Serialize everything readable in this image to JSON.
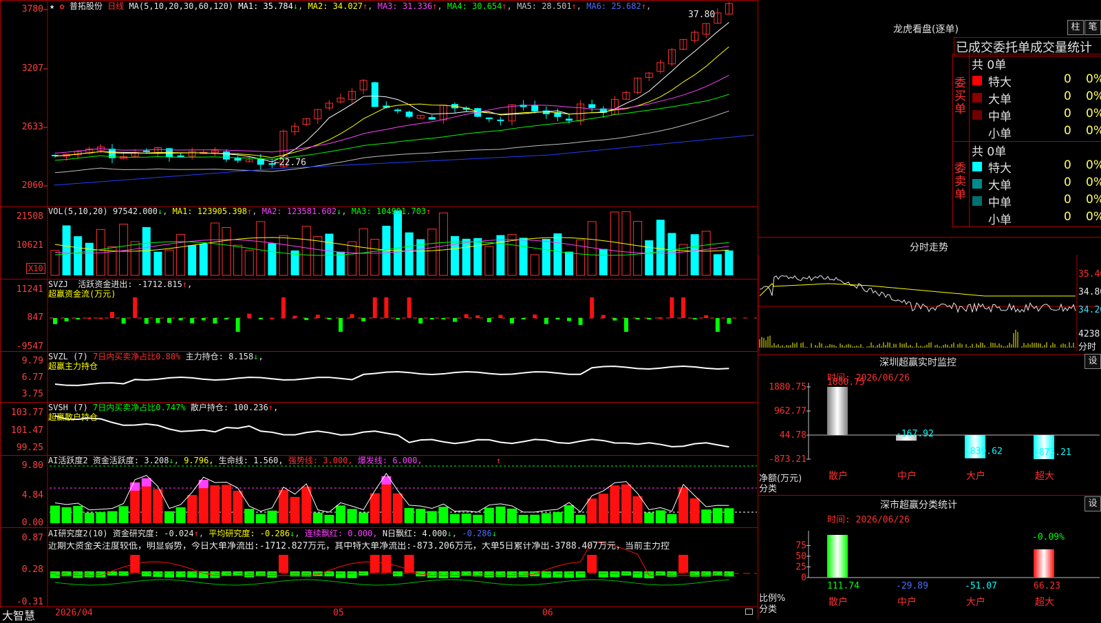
{
  "main": {
    "name": "普拓股份",
    "period": "日线",
    "ma_label": "MA(5,10,20,30,60,120)",
    "ma": [
      {
        "label": "MA1:",
        "value": "35.784",
        "arrow": "↓",
        "color": "#ffffff"
      },
      {
        "label": "MA2:",
        "value": "34.027",
        "arrow": "↑",
        "color": "#ffff00"
      },
      {
        "label": "MA3:",
        "value": "31.336",
        "arrow": "↑",
        "color": "#ff40ff"
      },
      {
        "label": "MA4:",
        "value": "30.654",
        "arrow": "↑",
        "color": "#00ff00"
      },
      {
        "label": "MA5:",
        "value": "28.501",
        "arrow": "↑",
        "color": "#c0c0c0"
      },
      {
        "label": "MA6:",
        "value": "25.682",
        "arrow": "↑",
        "color": "#4a6cff"
      }
    ],
    "y_labels": [
      "3780",
      "3207",
      "2633",
      "2060"
    ],
    "high_label": "37.80",
    "low_label": "22.76"
  },
  "vol": {
    "title": "VOL(5,10,20)",
    "value": "97542.000",
    "arrow": "↓",
    "ma1": "MA1: 123905.398",
    "ma1a": "↑",
    "ma2": "MA2: 123581.602",
    "ma2a": "↓",
    "ma3": "MA3: 104991.703",
    "ma3a": "↑",
    "y_labels": [
      "21508",
      "10621"
    ],
    "unit": "X10"
  },
  "svzj": {
    "title": "SVZJ",
    "label": "活跃资金进出: -1712.815",
    "arrow": "↑",
    "tail": ",",
    "sub": "超赢资金流(万元)",
    "y_labels": [
      "11241",
      "847",
      "-9547"
    ]
  },
  "svzl": {
    "title": "SVZL (7)",
    "pct": "7日内买卖净占比0.88%",
    "main_label": "主力持仓: 8.158",
    "arrow": "↓",
    "tail": ",",
    "sub": "超赢主力持仓",
    "y_labels": [
      "9.79",
      "6.77",
      "3.75"
    ]
  },
  "svsh": {
    "title": "SVSH (7)",
    "pct": "7日内买卖净占比0.747%",
    "main_label": "散户持仓: 100.236",
    "arrow": "↑",
    "tail": ",",
    "sub": "超赢散户持仓",
    "y_labels": [
      "103.77",
      "101.47",
      "99.25"
    ]
  },
  "ai1": {
    "title": "AI活跃度2",
    "a": "资金活跃度: 3.208",
    "aa": "↓",
    "b": "9.796,",
    "c": "生命线: 1.560,",
    "d": "强势线: 3.000,",
    "e": "爆发线: 6.000,",
    "f": "↑",
    "y_labels": [
      "9.80",
      "4.84",
      "0.00"
    ]
  },
  "ai2": {
    "title": "AI研究度2(10)",
    "a": "资金研究度: -0.024",
    "aa": "↑",
    "b": "平均研究度: -0.286",
    "ba": "↓",
    "c": "连续飘红: 0.000,",
    "d": "N日飘红: 4.000",
    "da": "↓",
    "e": "-0.286",
    "ea": "↓",
    "note": "近期大资金关注度较低，明显弱势，今日大单净流出:-1712.827万元，其中特大单净流出:-873.206万元，大单5日累计净出-3788.407万元，当前主力控",
    "y_labels": [
      "0.87",
      "0.28",
      "-0.31"
    ]
  },
  "xaxis": {
    "brand": "大智慧",
    "d1": "2026/04",
    "d2": "05",
    "d3": "06"
  },
  "lhb": {
    "title": "龙虎看盘(逐单)",
    "btn1": "柱",
    "btn2": "笔",
    "header": "已成交委托单成交量统计",
    "buy_label": "委买单",
    "sell_label": "委卖单",
    "buy_total": "共 0单",
    "sell_total": "共 0单",
    "buy_rows": [
      {
        "name": "特大",
        "v": "0",
        "p": "0%",
        "color": "#ff0000"
      },
      {
        "name": "大单",
        "v": "0",
        "p": "0%",
        "color": "#8b0000"
      },
      {
        "name": "中单",
        "v": "0",
        "p": "0%",
        "color": "#700000"
      },
      {
        "name": "小单",
        "v": "0",
        "p": "0%",
        "color": "#000000"
      }
    ],
    "sell_rows": [
      {
        "name": "特大",
        "v": "0",
        "p": "0%",
        "color": "#00ffff"
      },
      {
        "name": "大单",
        "v": "0",
        "p": "0%",
        "color": "#008b8b"
      },
      {
        "name": "中单",
        "v": "0",
        "p": "0%",
        "color": "#007070"
      },
      {
        "name": "小单",
        "v": "0",
        "p": "0%",
        "color": "#000000"
      }
    ]
  },
  "fs": {
    "title": "分时走势",
    "y1": "35.40",
    "y2": "34.80",
    "y3": "34.20",
    "vol": "4238",
    "vol_unit": "分时"
  },
  "sz": {
    "title": "深圳超赢实时监控",
    "btn": "设",
    "time": "时间: 2026/06/26",
    "y": [
      "1880.75",
      "962.77",
      "44.78",
      "-873.21"
    ],
    "ylab": "净额(万元)",
    "xlab": "分类",
    "cats": [
      "散户",
      "中户",
      "大户",
      "超大"
    ],
    "vals": [
      "1880.75",
      "-167.92",
      "-839.62",
      "-873.21"
    ],
    "chart_data": {
      "type": "bar",
      "categories": [
        "散户",
        "中户",
        "大户",
        "超大"
      ],
      "values": [
        1880.75,
        -167.92,
        -839.62,
        -873.21
      ],
      "ylim": [
        -873.21,
        1880.75
      ],
      "ylabel": "净额(万元)",
      "xlabel": "分类"
    }
  },
  "ss": {
    "title": "深市超赢分类统计",
    "btn": "设",
    "time": "时间: 2026/06/26",
    "y": [
      "75",
      "50",
      "25",
      "0"
    ],
    "ylab": "比例%",
    "xlab": "分类",
    "pct": "-0.09%",
    "cats": [
      "散户",
      "中户",
      "大户",
      "超大"
    ],
    "vals": [
      "111.74",
      "-29.89",
      "-51.07",
      "66.23"
    ],
    "chart_data": {
      "type": "bar",
      "categories": [
        "散户",
        "中户",
        "大户",
        "超大"
      ],
      "values": [
        111.74,
        -29.89,
        -51.07,
        66.23
      ],
      "ylim": [
        0,
        100
      ],
      "ylabel": "比例%",
      "xlabel": "分类"
    }
  }
}
